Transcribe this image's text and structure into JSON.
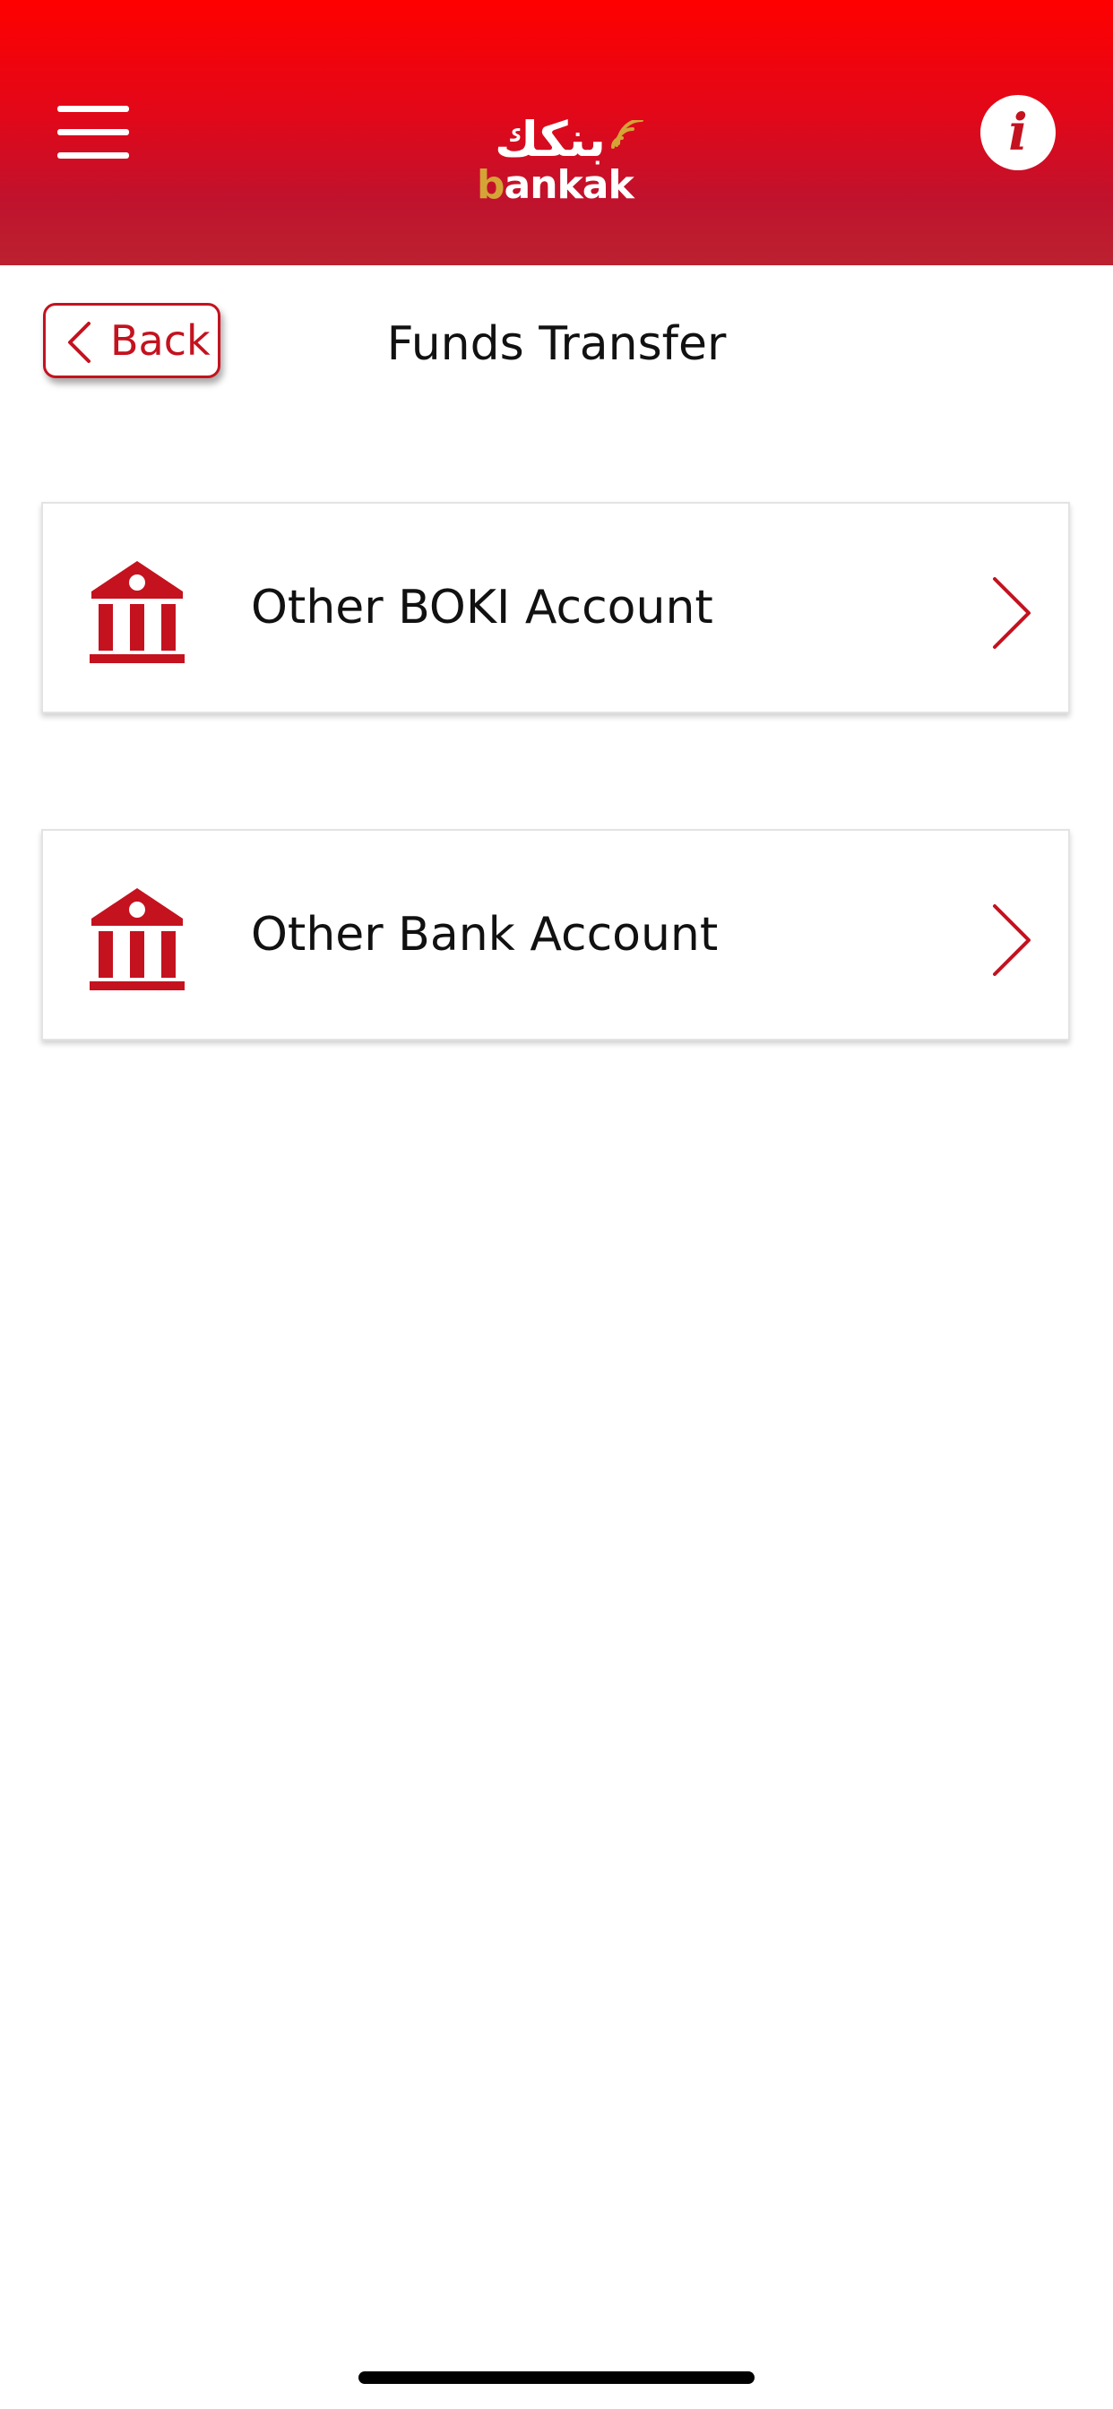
{
  "header": {
    "logo": {
      "arabic_text": "بنكك",
      "latin_accent": "b",
      "latin_rest": "ankak"
    },
    "menu_icon": "hamburger-menu-icon",
    "info_icon": "info-icon",
    "info_glyph": "i"
  },
  "nav": {
    "back_label": "Back",
    "page_title": "Funds Transfer"
  },
  "options": [
    {
      "label": "Other BOKI Account",
      "icon": "bank-icon",
      "chevron": "chevron-right-icon"
    },
    {
      "label": "Other Bank Account",
      "icon": "bank-icon",
      "chevron": "chevron-right-icon"
    }
  ],
  "colors": {
    "brand_red": "#c4121f",
    "header_top": "#ff0000",
    "header_bottom": "#bb2230",
    "logo_gold": "#d4a437",
    "text_dark": "#111111"
  }
}
